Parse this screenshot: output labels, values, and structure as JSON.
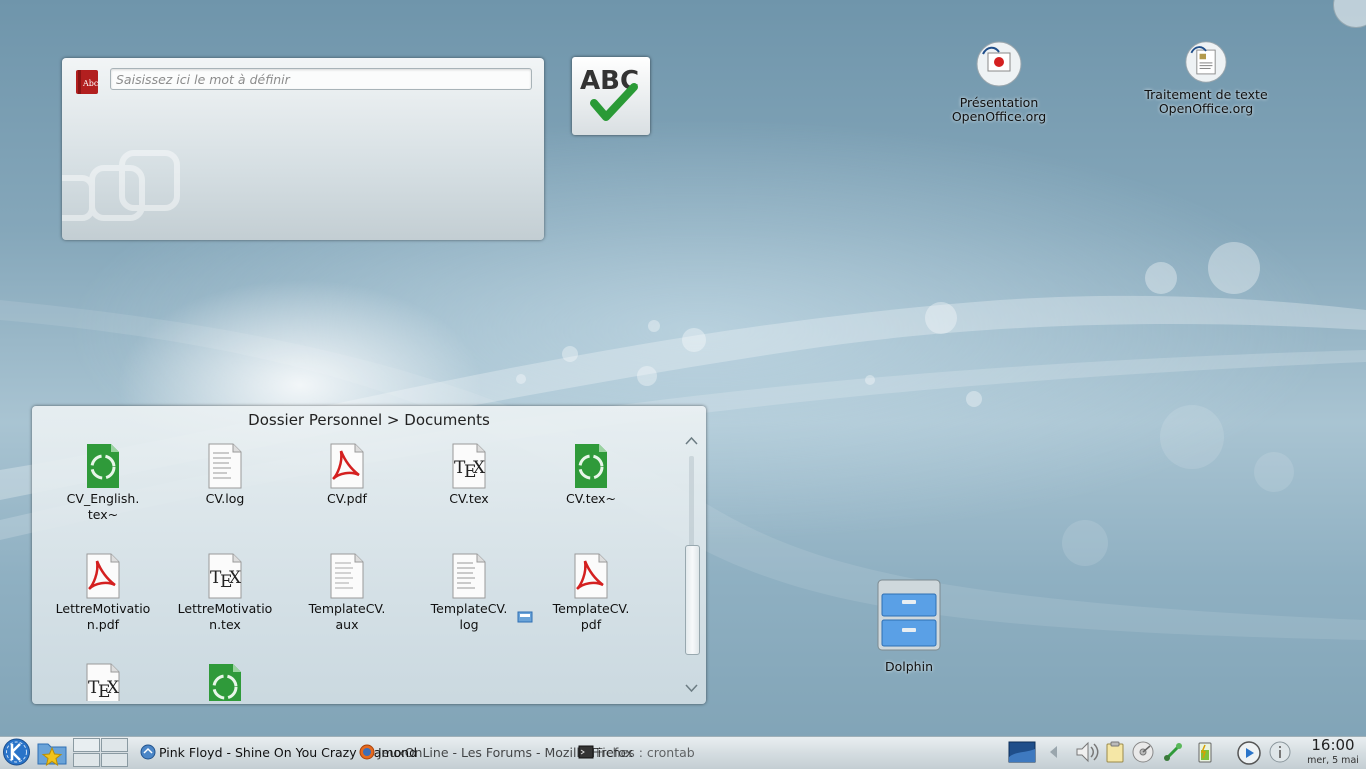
{
  "dictionary": {
    "placeholder": "Saisissez ici le mot à définir"
  },
  "desktop_icons": [
    {
      "label_line1": "Présentation",
      "label_line2": "OpenOffice.org"
    },
    {
      "label_line1": "Traitement de texte",
      "label_line2": "OpenOffice.org"
    },
    {
      "label_line1": "Dolphin",
      "label_line2": ""
    }
  ],
  "folder_view": {
    "title": "Dossier Personnel > Documents",
    "items": [
      {
        "line1": "CV_English.",
        "line2": "tex~",
        "icon": "recycle-icon"
      },
      {
        "line1": "CV.log",
        "line2": "",
        "icon": "text-file-icon"
      },
      {
        "line1": "CV.pdf",
        "line2": "",
        "icon": "pdf-icon"
      },
      {
        "line1": "CV.tex",
        "line2": "",
        "icon": "tex-icon"
      },
      {
        "line1": "CV.tex~",
        "line2": "",
        "icon": "recycle-icon"
      },
      {
        "line1": "LettreMotivatio",
        "line2": "n.pdf",
        "icon": "pdf-icon"
      },
      {
        "line1": "LettreMotivatio",
        "line2": "n.tex",
        "icon": "tex-icon"
      },
      {
        "line1": "TemplateCV.",
        "line2": "aux",
        "icon": "text-file-icon"
      },
      {
        "line1": "TemplateCV.",
        "line2": "log",
        "icon": "text-file-icon"
      },
      {
        "line1": "TemplateCV.",
        "line2": "pdf",
        "icon": "pdf-icon"
      },
      {
        "line1": "",
        "line2": "",
        "icon": "tex-icon"
      },
      {
        "line1": "",
        "line2": "",
        "icon": "recycle-icon"
      }
    ]
  },
  "taskbar": {
    "tasks": [
      "Pink Floyd - Shine On You Crazy Diamond",
      "JeuxOnLine - Les Forums - Mozilla Firefox",
      "Fiches : crontab"
    ]
  },
  "clock": {
    "time": "16:00",
    "date": "mer, 5 mai"
  },
  "colors": {
    "accent": "#2a74c9",
    "pdf_red": "#d42020",
    "recycle_green": "#2f9a3a"
  }
}
